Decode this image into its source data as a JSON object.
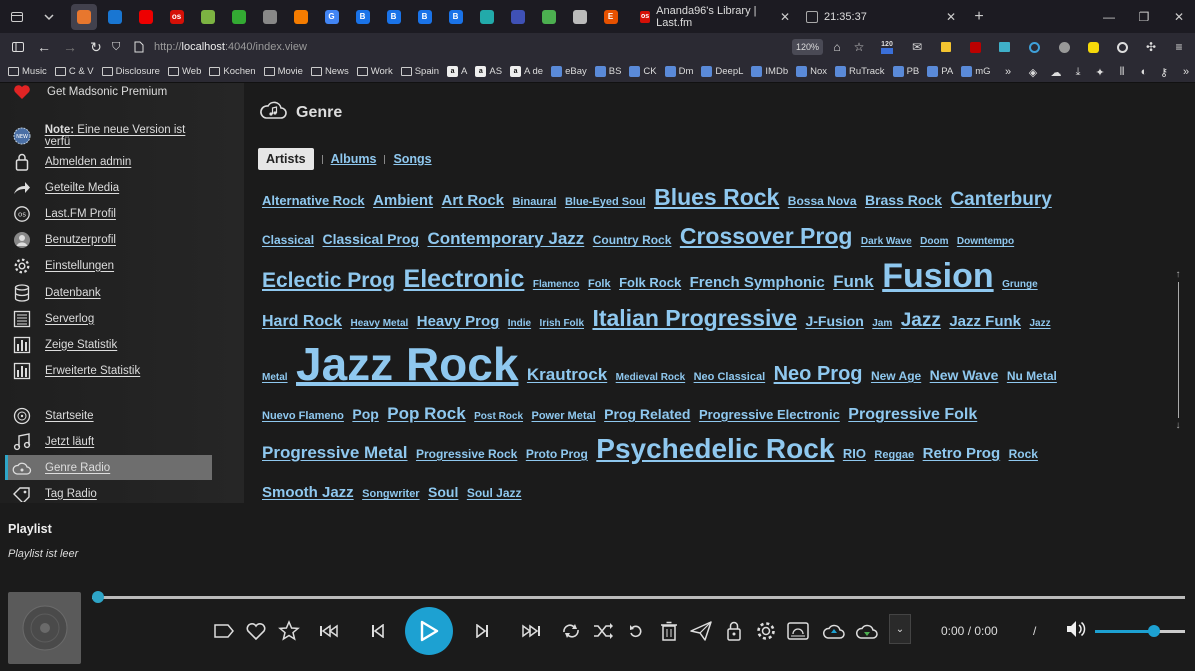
{
  "browser": {
    "active_tab_title": "Ananda96's Library | Last.fm",
    "second_tab_title": "21:35:37",
    "url_scheme": "http://",
    "url_host": "localhost",
    "url_rest": ":4040/index.view",
    "zoom": "120%",
    "badge_count": "120",
    "pinned_tabs": [
      {
        "letter": "",
        "color": "#e8772e"
      },
      {
        "letter": "",
        "color": "#1976d2"
      },
      {
        "letter": "",
        "color": "#e00"
      },
      {
        "letter": "os",
        "color": "#d51007"
      },
      {
        "letter": "",
        "color": "#7cb342"
      },
      {
        "letter": "",
        "color": "#3a3"
      },
      {
        "letter": "",
        "color": "#888"
      },
      {
        "letter": "",
        "color": "#f57c00"
      },
      {
        "letter": "G",
        "color": "#4285f4"
      },
      {
        "letter": "B",
        "color": "#1a73e8"
      },
      {
        "letter": "B",
        "color": "#1a73e8"
      },
      {
        "letter": "B",
        "color": "#1a73e8"
      },
      {
        "letter": "B",
        "color": "#1a73e8"
      },
      {
        "letter": "",
        "color": "#2aa"
      },
      {
        "letter": "",
        "color": "#3f51b5"
      },
      {
        "letter": "",
        "color": "#4caf50"
      },
      {
        "letter": "",
        "color": "#bbb"
      },
      {
        "letter": "E",
        "color": "#e65100"
      }
    ],
    "bookmarks": [
      {
        "label": "Music",
        "kind": "folder"
      },
      {
        "label": "C & V",
        "kind": "folder"
      },
      {
        "label": "Disclosure",
        "kind": "folder"
      },
      {
        "label": "Web",
        "kind": "folder"
      },
      {
        "label": "Kochen",
        "kind": "folder"
      },
      {
        "label": "Movie",
        "kind": "folder"
      },
      {
        "label": "News",
        "kind": "folder"
      },
      {
        "label": "Work",
        "kind": "folder"
      },
      {
        "label": "Spain",
        "kind": "folder"
      },
      {
        "label": "A",
        "kind": "a"
      },
      {
        "label": "AS",
        "kind": "a"
      },
      {
        "label": "A de",
        "kind": "a"
      },
      {
        "label": "eBay",
        "kind": "site"
      },
      {
        "label": "BS",
        "kind": "site"
      },
      {
        "label": "CK",
        "kind": "site"
      },
      {
        "label": "Dm",
        "kind": "site"
      },
      {
        "label": "DeepL",
        "kind": "site"
      },
      {
        "label": "IMDb",
        "kind": "site"
      },
      {
        "label": "Nox",
        "kind": "site"
      },
      {
        "label": "RuTrack",
        "kind": "site"
      },
      {
        "label": "PB",
        "kind": "site"
      },
      {
        "label": "PA",
        "kind": "site"
      },
      {
        "label": "mG",
        "kind": "site"
      }
    ]
  },
  "sidebar": {
    "items": [
      {
        "label": "Get Madsonic Premium",
        "icon": "heart-icon",
        "underline": false,
        "bold_prefix": ""
      },
      {
        "label": " Eine neue Version ist verfü",
        "icon": "new-badge-icon",
        "underline": true,
        "bold_prefix": "Note:"
      },
      {
        "label": "Abmelden admin",
        "icon": "lock-icon",
        "underline": true,
        "bold_prefix": ""
      },
      {
        "label": "Geteilte Media",
        "icon": "share-icon",
        "underline": true,
        "bold_prefix": ""
      },
      {
        "label": "Last.FM Profil",
        "icon": "lastfm-icon",
        "underline": true,
        "bold_prefix": ""
      },
      {
        "label": "Benutzerprofil",
        "icon": "user-icon",
        "underline": true,
        "bold_prefix": ""
      },
      {
        "label": "Einstellungen",
        "icon": "gear-icon",
        "underline": true,
        "bold_prefix": ""
      },
      {
        "label": "Datenbank",
        "icon": "database-icon",
        "underline": true,
        "bold_prefix": ""
      },
      {
        "label": "Serverlog",
        "icon": "log-icon",
        "underline": true,
        "bold_prefix": ""
      },
      {
        "label": "Zeige Statistik",
        "icon": "stats-icon",
        "underline": true,
        "bold_prefix": ""
      },
      {
        "label": "Erweiterte Statistik",
        "icon": "stats-icon",
        "underline": true,
        "bold_prefix": ""
      },
      {
        "label": "Startseite",
        "icon": "home-disc-icon",
        "underline": true,
        "bold_prefix": ""
      },
      {
        "label": "Jetzt läuft",
        "icon": "music-note-icon",
        "underline": true,
        "bold_prefix": ""
      },
      {
        "label": "Genre Radio",
        "icon": "cloud-radio-icon",
        "underline": true,
        "bold_prefix": "",
        "selected": true
      },
      {
        "label": "Tag Radio",
        "icon": "tag-radio-icon",
        "underline": true,
        "bold_prefix": ""
      }
    ]
  },
  "main": {
    "title": "Genre",
    "tabs": [
      "Artists",
      "Albums",
      "Songs"
    ],
    "tag_color": "#8fc8ef",
    "tags": [
      {
        "t": "Alternative Rock",
        "s": 13
      },
      {
        "t": "Ambient",
        "s": 15
      },
      {
        "t": "Art Rock",
        "s": 15
      },
      {
        "t": "Binaural",
        "s": 11
      },
      {
        "t": "Blue-Eyed Soul",
        "s": 11
      },
      {
        "t": "Blues Rock",
        "s": 23
      },
      {
        "t": "Bossa Nova",
        "s": 12
      },
      {
        "t": "Brass Rock",
        "s": 14
      },
      {
        "t": "Canterbury",
        "s": 19
      },
      {
        "t": "Classical",
        "s": 12
      },
      {
        "t": "Classical Prog",
        "s": 14
      },
      {
        "t": "Contemporary Jazz",
        "s": 17
      },
      {
        "t": "Country Rock",
        "s": 12
      },
      {
        "t": "Crossover Prog",
        "s": 23
      },
      {
        "t": "Dark Wave",
        "s": 10
      },
      {
        "t": "Doom",
        "s": 10
      },
      {
        "t": "Downtempo",
        "s": 10
      },
      {
        "t": "Eclectic Prog",
        "s": 21
      },
      {
        "t": "Electronic",
        "s": 25
      },
      {
        "t": "Flamenco",
        "s": 10
      },
      {
        "t": "Folk",
        "s": 11
      },
      {
        "t": "Folk Rock",
        "s": 13
      },
      {
        "t": "French Symphonic",
        "s": 15
      },
      {
        "t": "Funk",
        "s": 17
      },
      {
        "t": "Fusion",
        "s": 34
      },
      {
        "t": "Grunge",
        "s": 10
      },
      {
        "t": "Hard Rock",
        "s": 16
      },
      {
        "t": "Heavy Metal",
        "s": 10
      },
      {
        "t": "Heavy Prog",
        "s": 15
      },
      {
        "t": "Indie",
        "s": 10
      },
      {
        "t": "Irish Folk",
        "s": 10
      },
      {
        "t": "Italian Progressive",
        "s": 23
      },
      {
        "t": "J-Fusion",
        "s": 14
      },
      {
        "t": "Jam",
        "s": 10
      },
      {
        "t": "Jazz",
        "s": 19
      },
      {
        "t": "Jazz Funk",
        "s": 15
      },
      {
        "t": "Jazz Metal",
        "s": 10
      },
      {
        "t": "Jazz Rock",
        "s": 46
      },
      {
        "t": "Krautrock",
        "s": 17
      },
      {
        "t": "Medieval Rock",
        "s": 10
      },
      {
        "t": "Neo Classical",
        "s": 11
      },
      {
        "t": "Neo Prog",
        "s": 20
      },
      {
        "t": "New Age",
        "s": 12
      },
      {
        "t": "New Wave",
        "s": 14
      },
      {
        "t": "Nu Metal",
        "s": 12
      },
      {
        "t": "Nuevo Flameno",
        "s": 11
      },
      {
        "t": "Pop",
        "s": 14
      },
      {
        "t": "Pop Rock",
        "s": 17
      },
      {
        "t": "Post Rock",
        "s": 10
      },
      {
        "t": "Power Metal",
        "s": 11
      },
      {
        "t": "Prog Related",
        "s": 14
      },
      {
        "t": "Progressive Electronic",
        "s": 13
      },
      {
        "t": "Progressive Folk",
        "s": 16
      },
      {
        "t": "Progressive Metal",
        "s": 17
      },
      {
        "t": "Progressive Rock",
        "s": 12
      },
      {
        "t": "Proto Prog",
        "s": 12
      },
      {
        "t": "Psychedelic Rock",
        "s": 28
      },
      {
        "t": "RIO",
        "s": 13
      },
      {
        "t": "Reggae",
        "s": 11
      },
      {
        "t": "Retro Prog",
        "s": 15
      },
      {
        "t": "Rock",
        "s": 12
      },
      {
        "t": "Smooth Jazz",
        "s": 15
      },
      {
        "t": "Songwriter",
        "s": 11
      },
      {
        "t": "Soul",
        "s": 14
      },
      {
        "t": "Soul Jazz",
        "s": 12
      }
    ]
  },
  "playlist": {
    "title": "Playlist",
    "empty": "Playlist ist leer"
  },
  "player": {
    "time": "0:00 / 0:00",
    "time_sep": "/",
    "progress": 0,
    "volume": 0.65,
    "accent": "#1da1d2"
  }
}
